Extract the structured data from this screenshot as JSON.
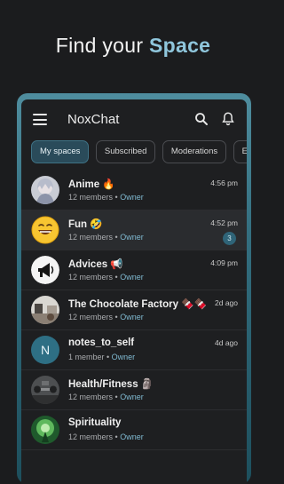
{
  "headline": {
    "prefix": "Find your",
    "accent": "Space"
  },
  "app": {
    "title": "NoxChat"
  },
  "tabs": [
    {
      "label": "My spaces",
      "active": true
    },
    {
      "label": "Subscribed",
      "active": false
    },
    {
      "label": "Moderations",
      "active": false
    },
    {
      "label": "Explo",
      "active": false
    }
  ],
  "rows": [
    {
      "title": "Anime 🔥",
      "members": "12 members",
      "role": "Owner",
      "time": "4:56 pm",
      "badge": null
    },
    {
      "title": "Fun 🤣",
      "members": "12 members",
      "role": "Owner",
      "time": "4:52 pm",
      "badge": "3"
    },
    {
      "title": "Advices 📢",
      "members": "12 members",
      "role": "Owner",
      "time": "4:09 pm",
      "badge": null
    },
    {
      "title": "The Chocolate Factory 🍫🍫",
      "members": "12 members",
      "role": "Owner",
      "time": "2d ago",
      "badge": null
    },
    {
      "title": "notes_to_self",
      "members": "1 member",
      "role": "Owner",
      "time": "4d ago",
      "badge": null,
      "initial": "N"
    },
    {
      "title": "Health/Fitness 🗿",
      "members": "12 members",
      "role": "Owner",
      "time": "",
      "badge": null
    },
    {
      "title": "Spirituality",
      "members": "12 members",
      "role": "Owner",
      "time": "",
      "badge": null
    }
  ],
  "sep": " • "
}
